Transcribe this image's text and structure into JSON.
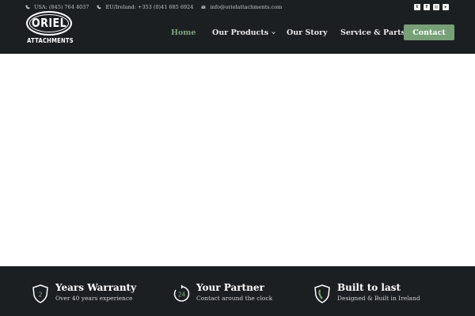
{
  "topbar": {
    "usa_phone": "USA: (845) 764 4037",
    "eu_phone": "EU/Ireland: +353 (0)41 685 6924",
    "email": "info@orielattachments.com",
    "social_icons": [
      "twitter-icon",
      "facebook-icon",
      "instagram-icon",
      "youtube-icon"
    ]
  },
  "logo": {
    "name": "ORIEL",
    "sub": "ATTACHMENTS"
  },
  "nav": {
    "home": "Home",
    "products": "Our Products",
    "story": "Our Story",
    "service": "Service & Parts",
    "contact": "Contact"
  },
  "colors": {
    "header_bg": "#1c1f22",
    "accent": "#77a077",
    "active_link": "#7ea87e"
  },
  "features": [
    {
      "icon": "2",
      "title": "Years Warranty",
      "subtitle": "Over 40 years experience"
    },
    {
      "icon": "24",
      "title": "Your Partner",
      "subtitle": "Contact around the clock"
    },
    {
      "icon": "shield-icon",
      "title": "Built to last",
      "subtitle": "Designed & Built in Ireland"
    }
  ]
}
